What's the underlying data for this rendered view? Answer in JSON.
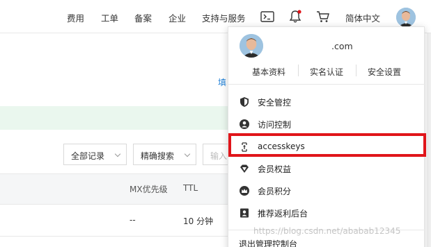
{
  "topnav": {
    "items": [
      "费用",
      "工单",
      "备案",
      "企业",
      "支持与服务"
    ],
    "language": "简体中文",
    "icons": [
      "terminal-icon",
      "bell-icon",
      "cart-icon"
    ],
    "notification_dot_color": "#e0151a"
  },
  "page": {
    "link_text": "填",
    "filters": {
      "all_records": "全部记录",
      "exact_search": "精确搜索",
      "input_placeholder": "输入"
    },
    "table": {
      "headers": [
        "MX优先级",
        "TTL"
      ],
      "row": [
        "--",
        "10 分钟"
      ]
    }
  },
  "user_menu": {
    "email": ".com",
    "quick_links": [
      "基本资料",
      "实名认证",
      "安全设置"
    ],
    "items": [
      {
        "label": "安全管控",
        "icon": "shield-icon"
      },
      {
        "label": "访问控制",
        "icon": "user-circle-icon"
      },
      {
        "label": "accesskeys",
        "icon": "key-icon"
      },
      {
        "label": "会员权益",
        "icon": "diamond-icon"
      },
      {
        "label": "会员积分",
        "icon": "crown-icon"
      },
      {
        "label": "推荐返利后台",
        "icon": "portrait-icon"
      }
    ],
    "logout": "退出管理控制台",
    "highlight_color": "#e0151a"
  },
  "watermark": "https://blog.csdn.net/ababab12345"
}
